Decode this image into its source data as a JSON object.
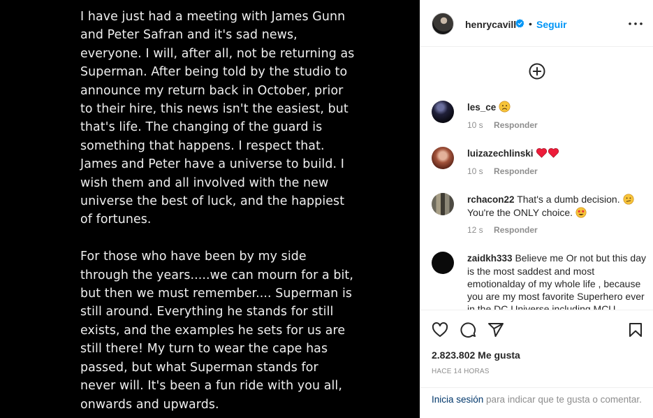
{
  "post": {
    "paragraph1_lines": [
      "I have just had a meeting with James Gunn",
      "and Peter Safran and it's sad news,",
      "everyone. I will, after all, not be returning as",
      "Superman. After being told by the studio to",
      "announce my return back in October, prior",
      "to their hire, this news isn't the easiest, but",
      "that's life. The changing of the guard is",
      "something that happens. I respect that.",
      "James and Peter have a universe to build. I",
      "wish them and all involved with the new",
      "universe the best of luck, and the happiest",
      "of fortunes."
    ],
    "paragraph2_lines": [
      "For those who have been by my side",
      "through the years.....we can mourn for a bit,",
      "but then we must remember.... Superman is",
      "still around. Everything he stands for still",
      "exists, and the examples he sets for us are",
      "still there! My turn to wear the cape has",
      "passed, but what Superman stands for",
      "never will. It's been a fun ride with you all,",
      "onwards and upwards."
    ]
  },
  "header": {
    "username": "henrycavill",
    "dot": "•",
    "follow_label": "Seguir",
    "icons": {
      "verified": "verified-badge-icon",
      "more": "more-options-icon"
    }
  },
  "comments": {
    "load_more_icon": "plus-circle-icon",
    "items": [
      {
        "author": "les_ce",
        "text": "",
        "emoji": "sad-face",
        "time": "10 s",
        "reply_label": "Responder"
      },
      {
        "author": "luizazechlinski",
        "text": "",
        "emoji": "two-hearts",
        "time": "10 s",
        "reply_label": "Responder"
      },
      {
        "author": "rchacon22",
        "text": "That's a dumb decision.",
        "text2": "You're the ONLY choice.",
        "emoji": "confused-face, star-eyes-face",
        "time": "12 s",
        "reply_label": "Responder"
      },
      {
        "author": "zaidkh333",
        "text": "Believe me Or not but this day is the most saddest and most emotionalday of my whole life , because you are my most favorite Superhero ever in the DC Universe including MCU",
        "time": "",
        "reply_label": ""
      }
    ]
  },
  "actions": {
    "icons": [
      "heart-icon",
      "comment-icon",
      "share-icon",
      "bookmark-icon"
    ],
    "likes": "2.823.802 Me gusta",
    "time_ago": "HACE 14 HORAS"
  },
  "login": {
    "link_label": "Inicia sesión",
    "rest_text": " para indicar que te gusta o comentar."
  },
  "colors": {
    "accent": "#0095f6",
    "link_dark": "#00376b",
    "muted": "#8e8e8e",
    "heart_red": "#ed1c3a",
    "emoji_yellow": "#f7c43a"
  }
}
